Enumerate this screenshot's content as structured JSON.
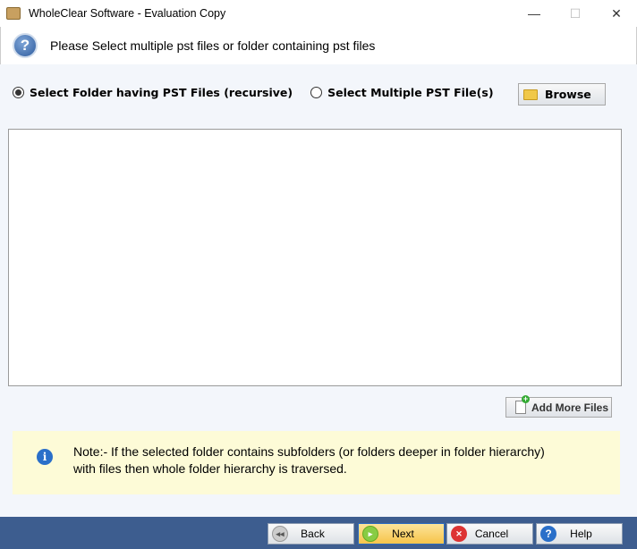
{
  "window": {
    "title": "WholeClear Software - Evaluation Copy",
    "minimize": "—",
    "maximize": "☐",
    "close": "✕"
  },
  "header": {
    "text": "Please Select multiple pst files or folder containing pst files",
    "icon": "question-icon"
  },
  "options": {
    "folder": "Select Folder having PST Files (recursive)",
    "multiple": "Select Multiple PST File(s)",
    "selected": "folder",
    "browse": "Browse"
  },
  "file_list": [],
  "add_more": "Add More Files",
  "note": {
    "line1": "Note:- If the selected folder contains subfolders (or folders deeper in folder hierarchy)",
    "line2": "with files then whole folder hierarchy is traversed."
  },
  "footer": {
    "back": "Back",
    "next": "Next",
    "cancel": "Cancel",
    "help": "Help"
  },
  "colors": {
    "footer": "#3d5d8f",
    "note_bg": "#fdfbd7",
    "next_bg": "#f6c44a"
  }
}
